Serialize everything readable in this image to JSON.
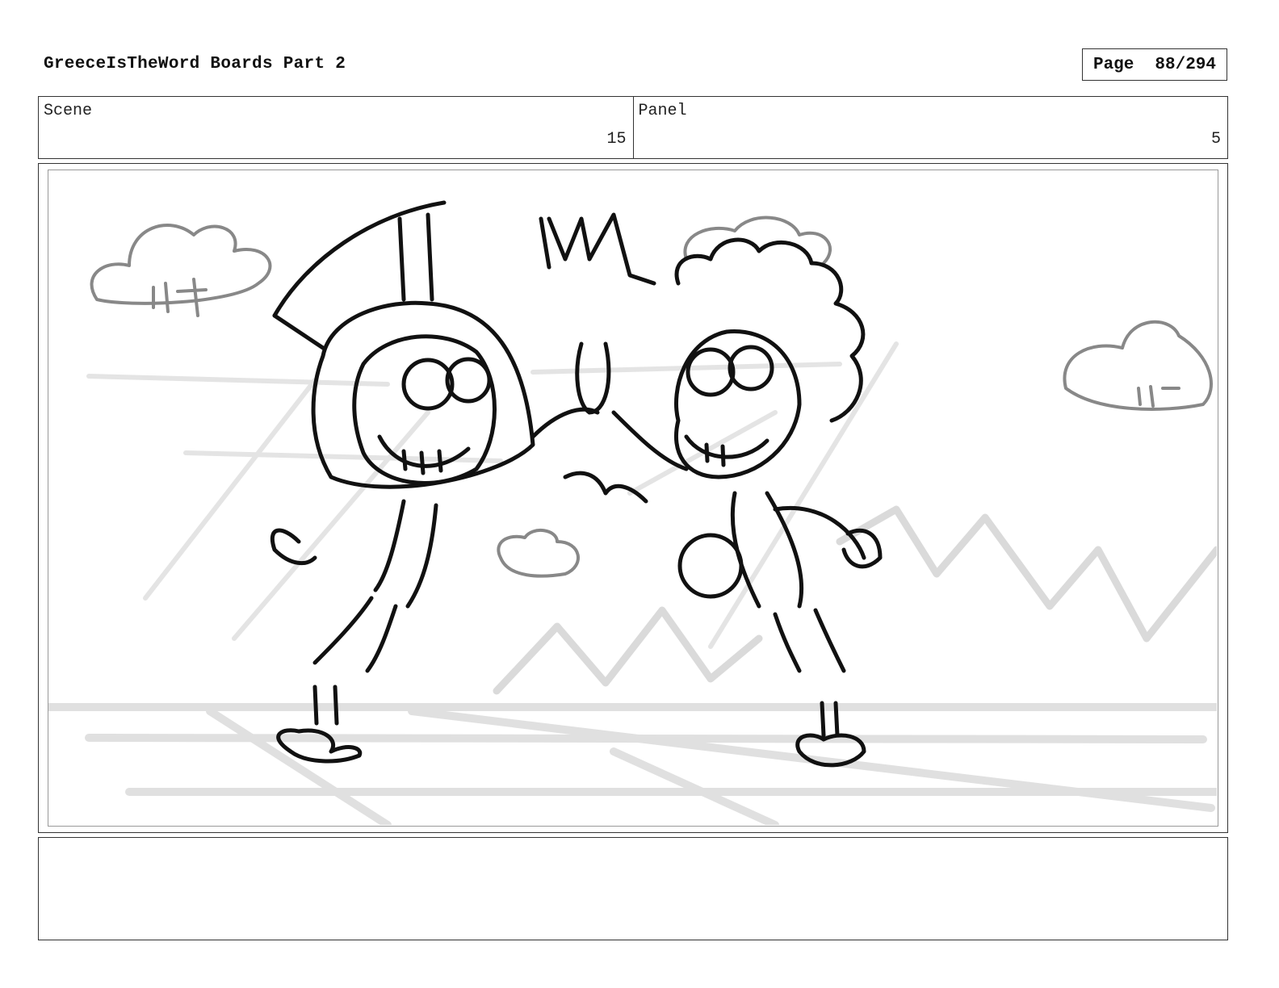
{
  "header": {
    "title": "GreeceIsTheWord Boards Part 2",
    "page_label": "Page",
    "page_number": "88/294"
  },
  "info": {
    "scene_label": "Scene",
    "scene_value": "15",
    "panel_label": "Panel",
    "panel_value": "5"
  },
  "notes": {
    "text": ""
  }
}
